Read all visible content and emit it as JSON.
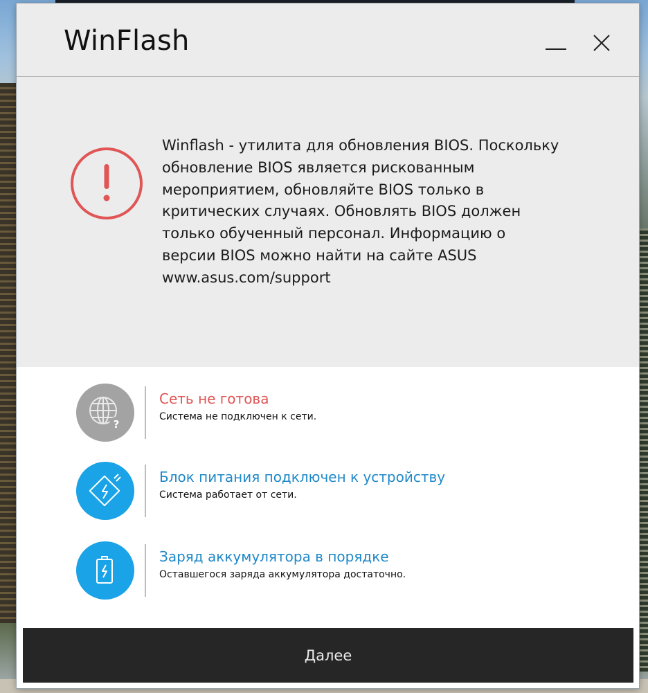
{
  "window": {
    "title": "WinFlash"
  },
  "notice": {
    "icon": "exclamation-circle-icon",
    "text": "Winflash - утилита для обновления BIOS. Поскольку\nобновление BIOS является рискованным\nмероприятием, обновляйте BIOS только в\nкритических случаях. Обновлять BIOS должен\nтолько обученный персонал. Информацию о\nверсии BIOS можно найти на сайте ASUS\nwww.asus.com/support"
  },
  "status": [
    {
      "icon": "globe-question-icon",
      "title": "Сеть не готова",
      "subtitle": "Система не подключен к сети.",
      "state": "error"
    },
    {
      "icon": "power-adapter-icon",
      "title": "Блок питания подключен к устройству",
      "subtitle": "Система работает от сети.",
      "state": "ok"
    },
    {
      "icon": "battery-charge-icon",
      "title": "Заряд аккумулятора в порядке",
      "subtitle": "Оставшегося заряда аккумулятора достаточно.",
      "state": "ok"
    }
  ],
  "footer": {
    "next_label": "Далее"
  },
  "colors": {
    "error": "#e05555",
    "ok": "#1f88c8",
    "icon_blue": "#1aa3e6",
    "icon_gray": "#a3a3a3",
    "button_bg": "#262626"
  }
}
